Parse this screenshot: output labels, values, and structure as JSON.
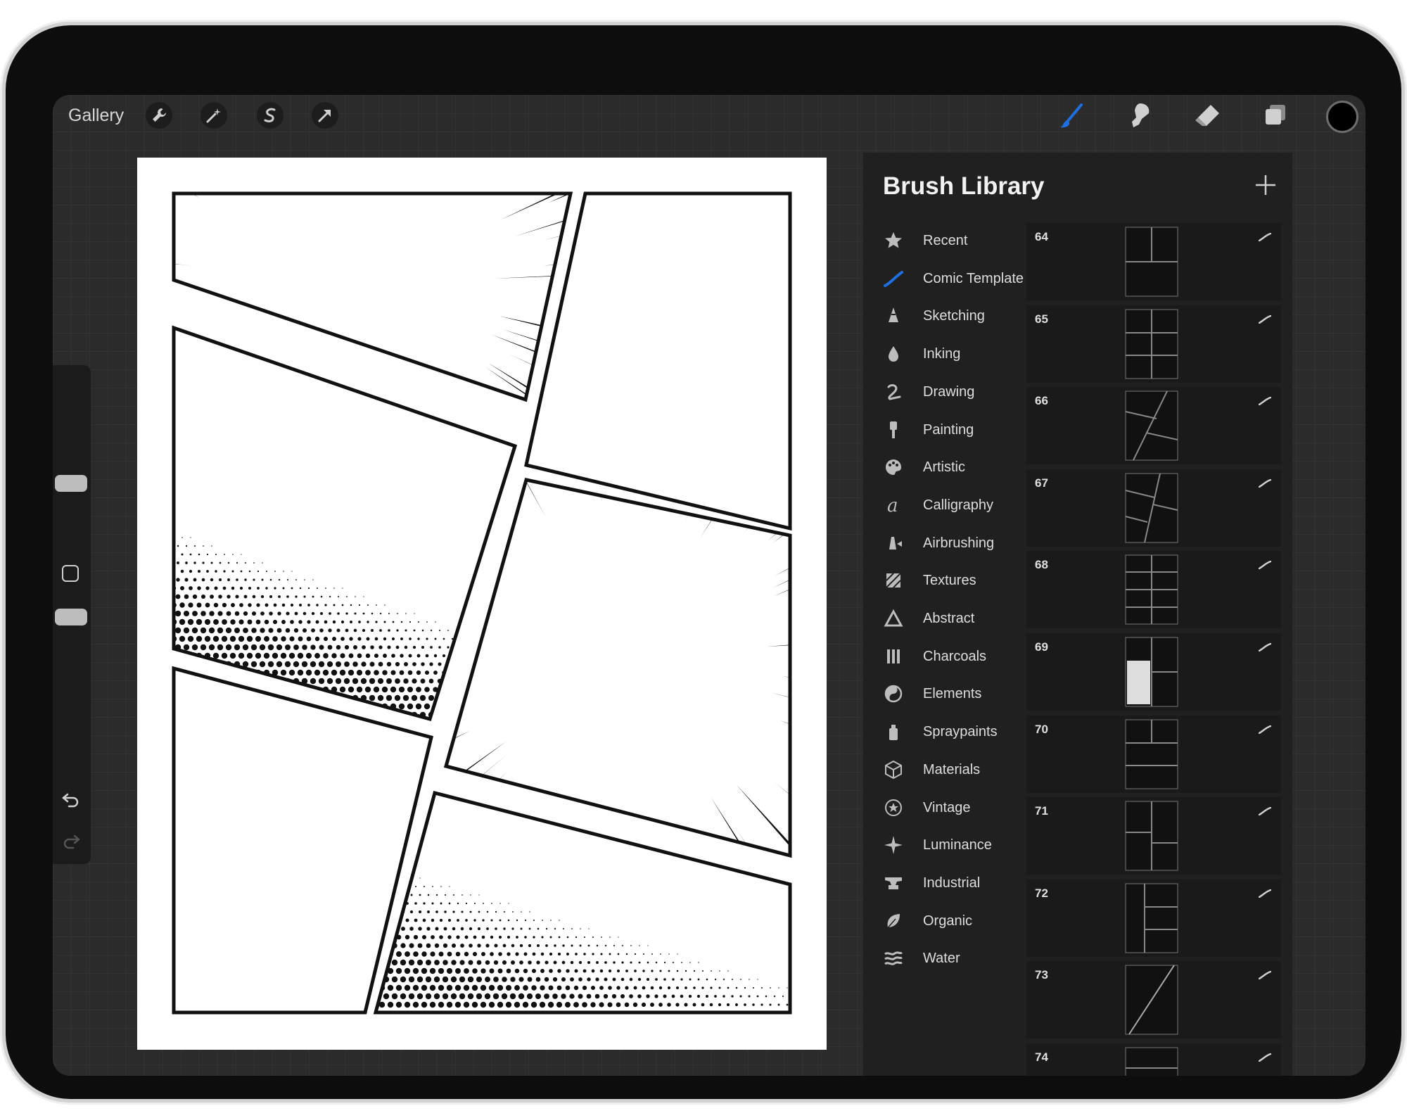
{
  "topbar": {
    "gallery_label": "Gallery",
    "left_tools": [
      "wrench-icon",
      "magic-wand-icon",
      "selection-s-icon",
      "transform-arrow-icon"
    ],
    "right_tools": [
      "brush-icon",
      "smudge-icon",
      "eraser-icon",
      "layers-icon"
    ],
    "active_tool_color": "#1e6fe0",
    "current_color": "#000000"
  },
  "sidebar": {
    "tools": [
      "brush-size-slider",
      "modify-button",
      "opacity-slider",
      "undo-icon",
      "redo-icon"
    ]
  },
  "brush_library": {
    "title": "Brush Library",
    "add_icon": "plus-icon",
    "categories": [
      {
        "label": "Recent",
        "icon": "star-icon"
      },
      {
        "label": "Comic Template",
        "icon": "stroke-icon"
      },
      {
        "label": "Sketching",
        "icon": "pencil-tip-icon"
      },
      {
        "label": "Inking",
        "icon": "ink-drop-icon"
      },
      {
        "label": "Drawing",
        "icon": "squiggle-icon"
      },
      {
        "label": "Painting",
        "icon": "paintbrush-icon"
      },
      {
        "label": "Artistic",
        "icon": "palette-icon"
      },
      {
        "label": "Calligraphy",
        "icon": "calligraphy-a-icon"
      },
      {
        "label": "Airbrushing",
        "icon": "airbrush-icon"
      },
      {
        "label": "Textures",
        "icon": "texture-icon"
      },
      {
        "label": "Abstract",
        "icon": "triangle-icon"
      },
      {
        "label": "Charcoals",
        "icon": "charcoal-icon"
      },
      {
        "label": "Elements",
        "icon": "yin-yang-icon"
      },
      {
        "label": "Spraypaints",
        "icon": "spray-can-icon"
      },
      {
        "label": "Materials",
        "icon": "cube-icon"
      },
      {
        "label": "Vintage",
        "icon": "star-badge-icon"
      },
      {
        "label": "Luminance",
        "icon": "sparkle-icon"
      },
      {
        "label": "Industrial",
        "icon": "anvil-icon"
      },
      {
        "label": "Organic",
        "icon": "leaf-icon"
      },
      {
        "label": "Water",
        "icon": "waves-icon"
      }
    ],
    "selected_category": "Comic Template",
    "brushes": [
      {
        "number": "64"
      },
      {
        "number": "65"
      },
      {
        "number": "66"
      },
      {
        "number": "67"
      },
      {
        "number": "68"
      },
      {
        "number": "69"
      },
      {
        "number": "70"
      },
      {
        "number": "71"
      },
      {
        "number": "72"
      },
      {
        "number": "73"
      },
      {
        "number": "74"
      }
    ]
  }
}
